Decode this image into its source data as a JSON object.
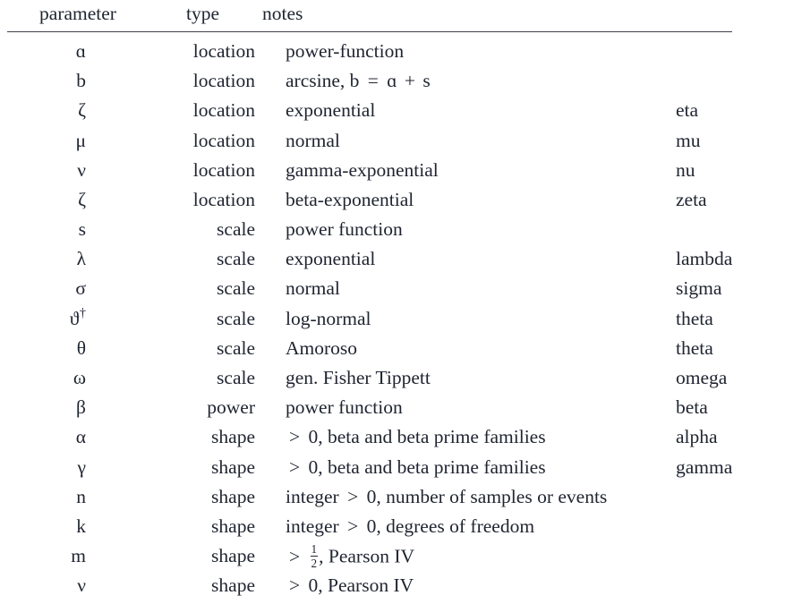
{
  "table": {
    "headers": {
      "parameter": "parameter",
      "type": "type",
      "notes": "notes",
      "name": ""
    },
    "rows": [
      {
        "symbol": "ɑ",
        "type": "location",
        "notes": "power-function",
        "name": ""
      },
      {
        "symbol": "b",
        "type": "location",
        "notes": "arcsine, b = ɑ + s",
        "name": ""
      },
      {
        "symbol": "ζ",
        "type": "location",
        "notes": "exponential",
        "name": "eta"
      },
      {
        "symbol": "μ",
        "type": "location",
        "notes": "normal",
        "name": "mu"
      },
      {
        "symbol": "ν",
        "type": "location",
        "notes": "gamma-exponential",
        "name": "nu"
      },
      {
        "symbol": "ζ",
        "type": "location",
        "notes": "beta-exponential",
        "name": "zeta"
      },
      {
        "symbol": "s",
        "type": "scale",
        "notes": "power function",
        "name": ""
      },
      {
        "symbol": "λ",
        "type": "scale",
        "notes": "exponential",
        "name": "lambda"
      },
      {
        "symbol": "σ",
        "type": "scale",
        "notes": "normal",
        "name": "sigma"
      },
      {
        "symbol": "ϑ",
        "type": "scale",
        "notes": "log-normal",
        "name": "theta"
      },
      {
        "symbol": "θ",
        "type": "scale",
        "notes": "Amoroso",
        "name": "theta"
      },
      {
        "symbol": "ω",
        "type": "scale",
        "notes": "gen. Fisher Tippett",
        "name": "omega"
      },
      {
        "symbol": "β",
        "type": "power",
        "notes": "power function",
        "name": "beta"
      },
      {
        "symbol": "α",
        "type": "shape",
        "notes": "> 0, beta and beta prime families",
        "name": "alpha"
      },
      {
        "symbol": "γ",
        "type": "shape",
        "notes": "> 0, beta and beta prime families",
        "name": "gamma"
      },
      {
        "symbol": "n",
        "type": "shape",
        "notes": "integer > 0, number of samples or events",
        "name": ""
      },
      {
        "symbol": "k",
        "type": "shape",
        "notes": "integer > 0, degrees of freedom",
        "name": ""
      },
      {
        "symbol": "m",
        "type": "shape",
        "notes": "> 1/2, Pearson IV",
        "name": ""
      },
      {
        "symbol": "ν",
        "type": "shape",
        "notes": "> 0, Pearson IV",
        "name": ""
      }
    ],
    "annotations": {
      "dagger": "†",
      "fraction_numerator": "1",
      "fraction_denominator": "2",
      "greater_than": ">",
      "equals": "=",
      "plus": "+"
    }
  },
  "colors": {
    "text": "#1f2430",
    "rule": "#3c3f4c",
    "background": "#ffffff"
  }
}
